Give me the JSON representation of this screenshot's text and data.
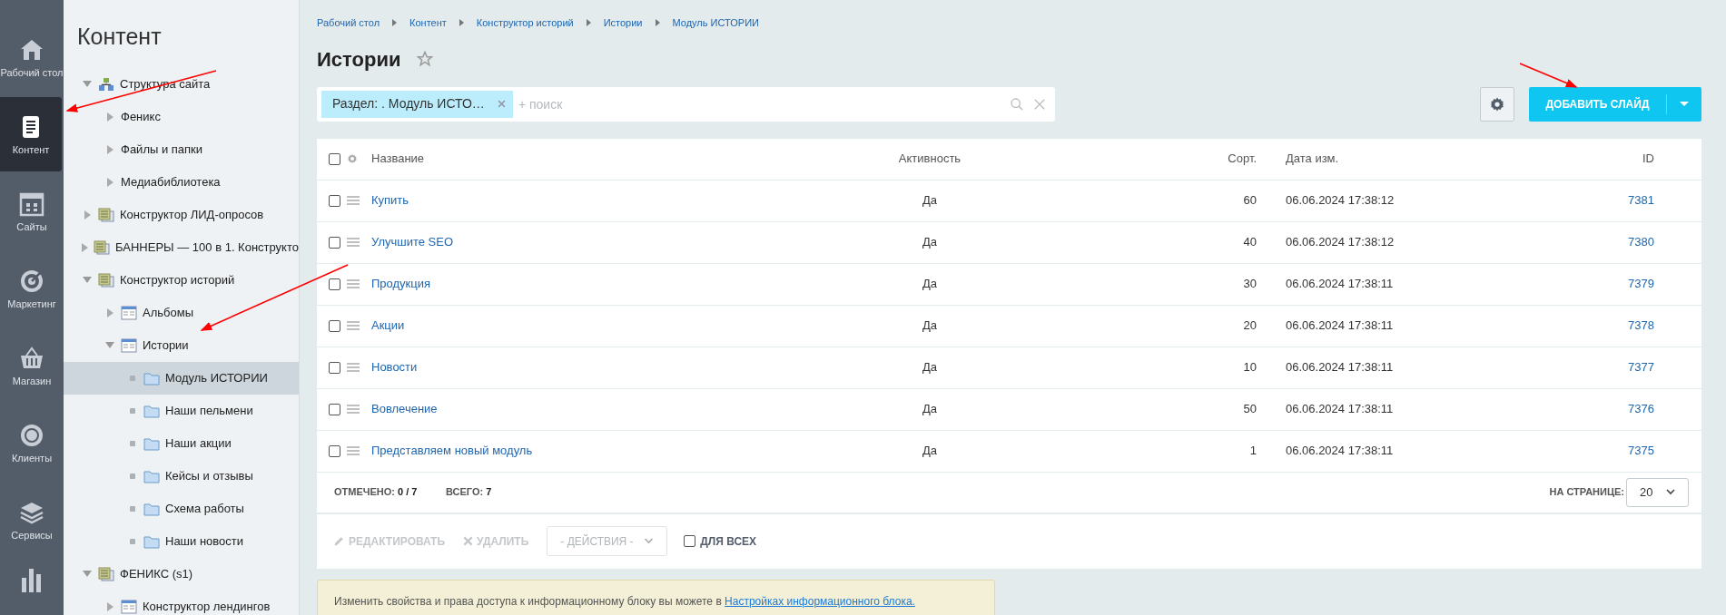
{
  "nav": [
    {
      "label": "Рабочий стол",
      "kind": "home",
      "selected": false
    },
    {
      "label": "Контент",
      "kind": "document",
      "selected": true
    },
    {
      "label": "Сайты",
      "kind": "calendar",
      "selected": false
    },
    {
      "label": "Маркетинг",
      "kind": "target",
      "selected": false
    },
    {
      "label": "Магазин",
      "kind": "basket",
      "selected": false
    },
    {
      "label": "Клиенты",
      "kind": "cloud",
      "selected": false
    },
    {
      "label": "Сервисы",
      "kind": "layers",
      "selected": false
    }
  ],
  "tree": {
    "title": "Контент",
    "items": [
      {
        "kind": "structure",
        "label": "Структура сайта",
        "expanded": true,
        "selected": false,
        "children": [
          {
            "kind": "plain",
            "label": "Феникс",
            "expanded": false,
            "selected": false
          },
          {
            "kind": "plain",
            "label": "Файлы и папки",
            "expanded": false,
            "selected": false
          },
          {
            "kind": "plain",
            "label": "Медиабиблиотека",
            "expanded": false,
            "selected": false
          }
        ]
      },
      {
        "kind": "iblock-type",
        "label": "Конструктор ЛИД-опросов",
        "expanded": false,
        "selected": false
      },
      {
        "kind": "iblock-type",
        "label": "БАННЕРЫ — 100 в 1. Конструкто",
        "expanded": false,
        "selected": false
      },
      {
        "kind": "iblock-type",
        "label": "Конструктор историй",
        "expanded": true,
        "selected": false,
        "children": [
          {
            "kind": "iblock",
            "label": "Альбомы",
            "expanded": false,
            "selected": false
          },
          {
            "kind": "iblock",
            "label": "Истории",
            "expanded": true,
            "selected": false,
            "children": [
              {
                "kind": "section",
                "label": "Модуль ИСТОРИИ",
                "selected": true
              },
              {
                "kind": "section",
                "label": "Наши пельмени",
                "selected": false
              },
              {
                "kind": "section",
                "label": "Наши акции",
                "selected": false
              },
              {
                "kind": "section",
                "label": "Кейсы и отзывы",
                "selected": false
              },
              {
                "kind": "section",
                "label": "Схема работы",
                "selected": false
              },
              {
                "kind": "section",
                "label": "Наши новости",
                "selected": false
              }
            ]
          }
        ]
      },
      {
        "kind": "iblock-type",
        "label": "ФЕНИКС (s1)",
        "expanded": true,
        "selected": false,
        "children": [
          {
            "kind": "iblock",
            "label": "Конструктор лендингов",
            "expanded": false,
            "selected": false
          }
        ]
      }
    ]
  },
  "breadcrumbs": [
    "Рабочий стол",
    "Контент",
    "Конструктор историй",
    "Истории",
    "Модуль ИСТОРИИ"
  ],
  "title": "Истории",
  "filter": {
    "chip": "Раздел: . Модуль ИСТО…",
    "placeholder": "+ поиск"
  },
  "add_button": "ДОБАВИТЬ СЛАЙД",
  "table": {
    "select_all_checked": false,
    "columns": [
      "Название",
      "Активность",
      "Сорт.",
      "Дата изм.",
      "ID"
    ],
    "rows": [
      {
        "name": "Купить",
        "active": "Да",
        "sort": "60",
        "date": "06.06.2024 17:38:12",
        "id": "7381",
        "checked": false
      },
      {
        "name": "Улучшите SEO",
        "active": "Да",
        "sort": "40",
        "date": "06.06.2024 17:38:12",
        "id": "7380",
        "checked": false
      },
      {
        "name": "Продукция",
        "active": "Да",
        "sort": "30",
        "date": "06.06.2024 17:38:11",
        "id": "7379",
        "checked": false
      },
      {
        "name": "Акции",
        "active": "Да",
        "sort": "20",
        "date": "06.06.2024 17:38:11",
        "id": "7378",
        "checked": false
      },
      {
        "name": "Новости",
        "active": "Да",
        "sort": "10",
        "date": "06.06.2024 17:38:11",
        "id": "7377",
        "checked": false
      },
      {
        "name": "Вовлечение",
        "active": "Да",
        "sort": "50",
        "date": "06.06.2024 17:38:11",
        "id": "7376",
        "checked": false
      },
      {
        "name": "Представляем новый модуль",
        "active": "Да",
        "sort": "1",
        "date": "06.06.2024 17:38:11",
        "id": "7375",
        "checked": false
      }
    ]
  },
  "footer": {
    "checked_label": "ОТМЕЧЕНО:",
    "checked_value": "0 / 7",
    "total_label": "ВСЕГО:",
    "total_value": "7",
    "per_page_label": "НА СТРАНИЦЕ:",
    "per_page": "20"
  },
  "actions": {
    "edit": {
      "label": "РЕДАКТИРОВАТЬ",
      "disabled": true
    },
    "delete": {
      "label": "УДАЛИТЬ",
      "disabled": true
    },
    "select": "- ДЕЙСТВИЯ -",
    "for_all": {
      "label": "ДЛЯ ВСЕХ",
      "checked": false
    }
  },
  "notice": {
    "text": "Изменить свойства и права доступа к информационному блоку вы можете в ",
    "link": "Настройках информационного блока."
  }
}
